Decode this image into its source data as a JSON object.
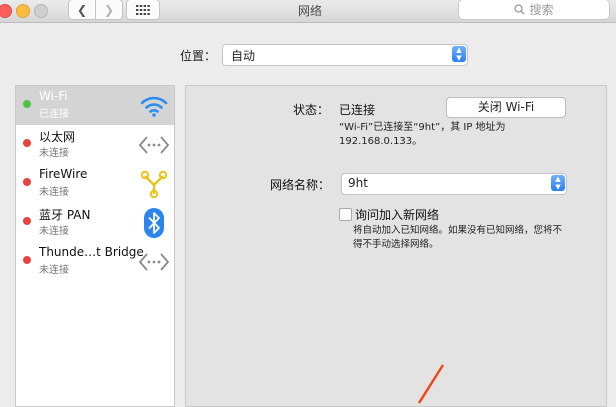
{
  "window": {
    "title": "网络",
    "search_placeholder": "搜索"
  },
  "location": {
    "label": "位置：",
    "value": "自动"
  },
  "services": [
    {
      "name": "Wi-Fi",
      "status": "已连接",
      "icon": "wifi-icon",
      "selected": true,
      "dot": "green"
    },
    {
      "name": "以太网",
      "status": "未连接",
      "icon": "ethernet-icon",
      "selected": false,
      "dot": "red"
    },
    {
      "name": "FireWire",
      "status": "未连接",
      "icon": "firewire-icon",
      "selected": false,
      "dot": "red"
    },
    {
      "name": "蓝牙 PAN",
      "status": "未连接",
      "icon": "bluetooth-icon",
      "selected": false,
      "dot": "red"
    },
    {
      "name": "Thunde…t Bridge",
      "status": "未连接",
      "icon": "thunderbolt-bridge-icon",
      "selected": false,
      "dot": "red"
    }
  ],
  "detail": {
    "status_label": "状态：",
    "status_value": "已连接",
    "toggle_button": "关闭 Wi-Fi",
    "status_desc_line1": "“Wi-Fi”已连接至“9ht”，其 IP 地址为",
    "status_desc_line2": "192.168.0.133。",
    "network_name_label": "网络名称：",
    "network_name_value": "9ht",
    "ask_join_label": "询问加入新网络",
    "ask_join_desc_line1": "将自动加入已知网络。如果没有已知网络，您将不",
    "ask_join_desc_line2": "得不手动选择网络。"
  },
  "colors": {
    "accent": "#2a7ef6",
    "connected": "#50c441",
    "disconnected": "#e8433f",
    "annotation_arrow": "#f04a1a"
  }
}
